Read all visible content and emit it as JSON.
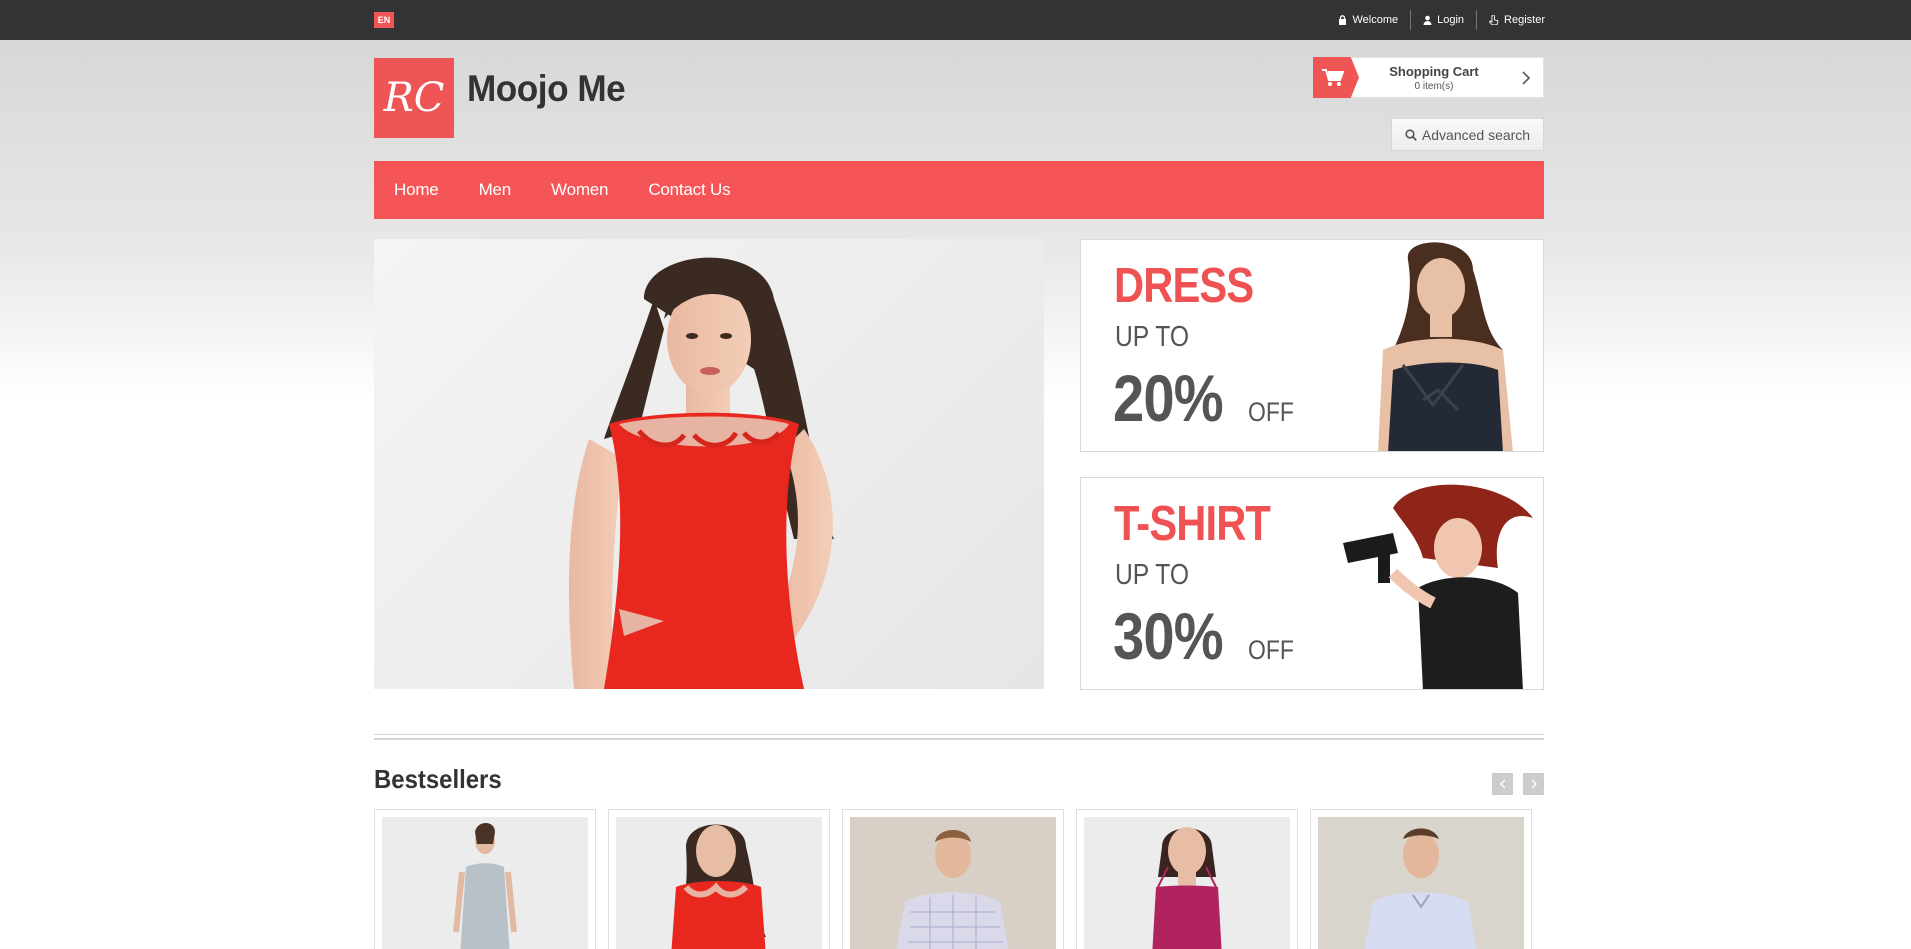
{
  "topbar": {
    "language": "EN",
    "links": {
      "welcome": "Welcome",
      "login": "Login",
      "register": "Register"
    }
  },
  "header": {
    "logo_text": "RC",
    "site_name": "Moojo Me",
    "cart": {
      "title": "Shopping Cart",
      "count": "0 item(s)"
    },
    "advanced_search": "Advanced search"
  },
  "nav": {
    "home": "Home",
    "men": "Men",
    "women": "Women",
    "contact": "Contact Us"
  },
  "banners": [
    {
      "headline": "DRESS",
      "upto": "UP TO",
      "percent": "20%",
      "off": "OFF"
    },
    {
      "headline": "T-SHIRT",
      "upto": "UP TO",
      "percent": "30%",
      "off": "OFF"
    }
  ],
  "bestsellers": {
    "title": "Bestsellers"
  },
  "colors": {
    "accent": "#f65557",
    "topbar": "#333333"
  }
}
